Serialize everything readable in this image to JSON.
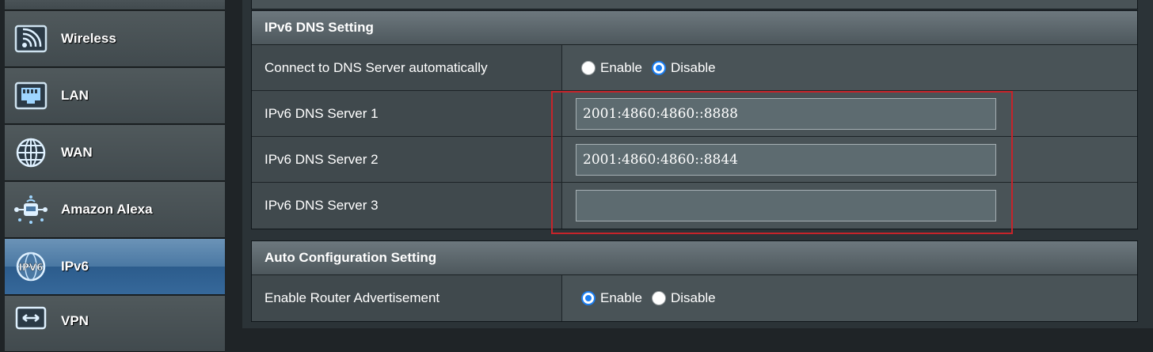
{
  "sidebar": {
    "items": [
      {
        "label": "Wireless",
        "icon": "wireless-icon",
        "active": false
      },
      {
        "label": "LAN",
        "icon": "lan-icon",
        "active": false
      },
      {
        "label": "WAN",
        "icon": "globe-icon",
        "active": false
      },
      {
        "label": "Amazon Alexa",
        "icon": "alexa-icon",
        "active": false
      },
      {
        "label": "IPv6",
        "icon": "ipv6-icon",
        "active": true
      },
      {
        "label": "VPN",
        "icon": "vpn-icon",
        "active": false
      }
    ]
  },
  "dns_section": {
    "title": "IPv6 DNS Setting",
    "connect_auto": {
      "label": "Connect to DNS Server automatically",
      "options": [
        "Enable",
        "Disable"
      ],
      "selected": "Disable"
    },
    "server1": {
      "label": "IPv6 DNS Server 1",
      "value": "2001:4860:4860::8888"
    },
    "server2": {
      "label": "IPv6 DNS Server 2",
      "value": "2001:4860:4860::8844"
    },
    "server3": {
      "label": "IPv6 DNS Server 3",
      "value": ""
    }
  },
  "auto_section": {
    "title": "Auto Configuration Setting",
    "router_adv": {
      "label": "Enable Router Advertisement",
      "options": [
        "Enable",
        "Disable"
      ],
      "selected": "Enable"
    }
  },
  "colors": {
    "accent": "#1b7ef2",
    "highlight": "#c6242a",
    "active_nav": "#3a6a9a"
  }
}
